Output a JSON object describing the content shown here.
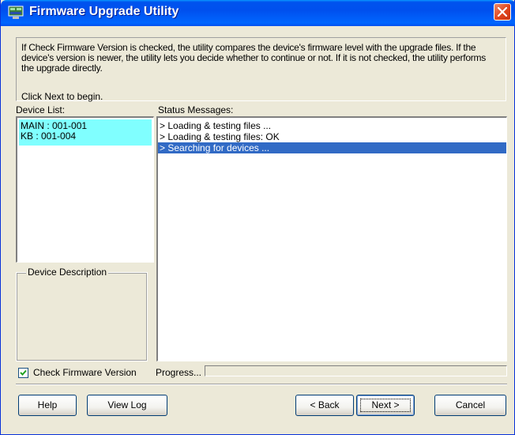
{
  "window": {
    "title": "Firmware Upgrade Utility"
  },
  "info": {
    "text": "If Check Firmware Version is checked, the utility compares the device's firmware level with the upgrade files. If the device's version is newer, the utility lets you decide whether to continue or not. If it is not checked, the utility performs the upgrade directly.",
    "click_next": "Click Next to begin."
  },
  "device_list": {
    "label": "Device List:",
    "items": [
      "MAIN : 001-001",
      "KB : 001-004"
    ]
  },
  "device_description": {
    "label": "Device Description"
  },
  "status": {
    "label": "Status Messages:",
    "messages": [
      "> Loading & testing files ...",
      "> Loading & testing files: OK",
      "> Searching for devices ..."
    ],
    "selected_index": 2
  },
  "options": {
    "check_firmware_label": "Check Firmware Version",
    "check_firmware_checked": true,
    "progress_label": "Progress...",
    "progress_value": 0
  },
  "buttons": {
    "help": "Help",
    "view_log": "View Log",
    "back": "< Back",
    "next": "Next >",
    "cancel": "Cancel"
  },
  "colors": {
    "device_selection": "#80ffff",
    "status_selection": "#316ac5",
    "titlebar": "#0053ee"
  }
}
